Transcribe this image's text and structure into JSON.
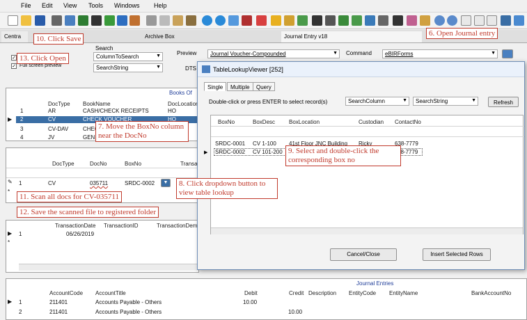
{
  "menu": [
    "File",
    "Edit",
    "View",
    "Tools",
    "Windows",
    "Help"
  ],
  "tabs": [
    {
      "label": "Centra"
    },
    {
      "label": "Archive Box"
    },
    {
      "label": "Journal Entry v18"
    }
  ],
  "tab_close": "×",
  "left_form": {
    "search_label": "Search",
    "column_value": "ColumnToSearch",
    "string_value": "SearchString",
    "checkbox1_label": "Full screen preview",
    "preview_label": "Preview",
    "preview_value": "Journal Voucher-Compounded",
    "command_label": "Command",
    "command_value": "eBIRForms",
    "dts_label": "DTS"
  },
  "books_panel": {
    "title": "Books Of",
    "headers": [
      "DocType",
      "BookName",
      "DocLocation"
    ],
    "rows": [
      {
        "num": "1",
        "doctype": "AR",
        "bookname": "CASH/CHECK RECEIPTS",
        "docloc": "HO"
      },
      {
        "num": "2",
        "doctype": "CV",
        "bookname": "CHECK VOUCHER",
        "docloc": "HO"
      },
      {
        "num": "3",
        "doctype": "CV-DAV",
        "bookname": "CHEC",
        "docloc": ""
      },
      {
        "num": "4",
        "doctype": "JV",
        "bookname": "GENE",
        "docloc": ""
      }
    ]
  },
  "docs_panel": {
    "headers": [
      "DocType",
      "DocNo",
      "BoxNo",
      "Transa"
    ],
    "row": {
      "num": "1",
      "doctype": "CV",
      "docno": "035711",
      "boxno": "SRDC-0002"
    }
  },
  "trans_panel": {
    "headers": [
      "TransactionDate",
      "TransactionID",
      "TransactionDem"
    ],
    "row": {
      "num": "1",
      "date": "06/26/2019"
    }
  },
  "journal_panel": {
    "title": "Journal Entries",
    "headers": [
      "AccountCode",
      "AccountTitle",
      "Debit",
      "Credit",
      "Description",
      "EntityCode",
      "EntityName",
      "BankAccountNo"
    ],
    "rows": [
      {
        "num": "1",
        "code": "211401",
        "title": "Accounts Payable - Others",
        "debit": "10.00",
        "credit": ""
      },
      {
        "num": "2",
        "code": "211401",
        "title": "Accounts Payable - Others",
        "debit": "",
        "credit": "10.00"
      }
    ]
  },
  "dialog": {
    "title": "TableLookupViewer [252]",
    "tabs": [
      "Single",
      "Multiple",
      "Query"
    ],
    "instruction": "Double-click or press ENTER to select record(s)",
    "column_value": "SearchColumn",
    "string_value": "SearchString",
    "refresh": "Refresh",
    "headers": [
      "BoxNo",
      "BoxDesc",
      "BoxLocation",
      "Custodian",
      "ContactNo"
    ],
    "rows": [
      {
        "boxno": "SRDC-0001",
        "desc": "CV 1-100",
        "loc": "41st Floor JNC Building",
        "cust": "Ricky",
        "contact": "638-7779"
      },
      {
        "boxno": "SRDC-0002",
        "desc": "CV 101-200",
        "loc": "",
        "cust": "",
        "contact": "38-7779"
      }
    ],
    "cancel": "Cancel/Close",
    "insert": "Insert Selected Rows"
  },
  "callouts": {
    "c6": "6. Open Journal entry",
    "c7": "7. Move the BoxNo column near the DocNo",
    "c8": "8. Click dropdown button to view table lookup",
    "c9": "9. Select and double-click the corresponding box no",
    "c10": "10. Click Save",
    "c11": "11. Scan all docs for CV-035711",
    "c12": "12. Save the scanned file to registered folder",
    "c13": "13. Click Open"
  },
  "colors": {
    "selection": "#3a6ea5",
    "callout": "#c0392b",
    "section_title": "#1f3d99"
  }
}
